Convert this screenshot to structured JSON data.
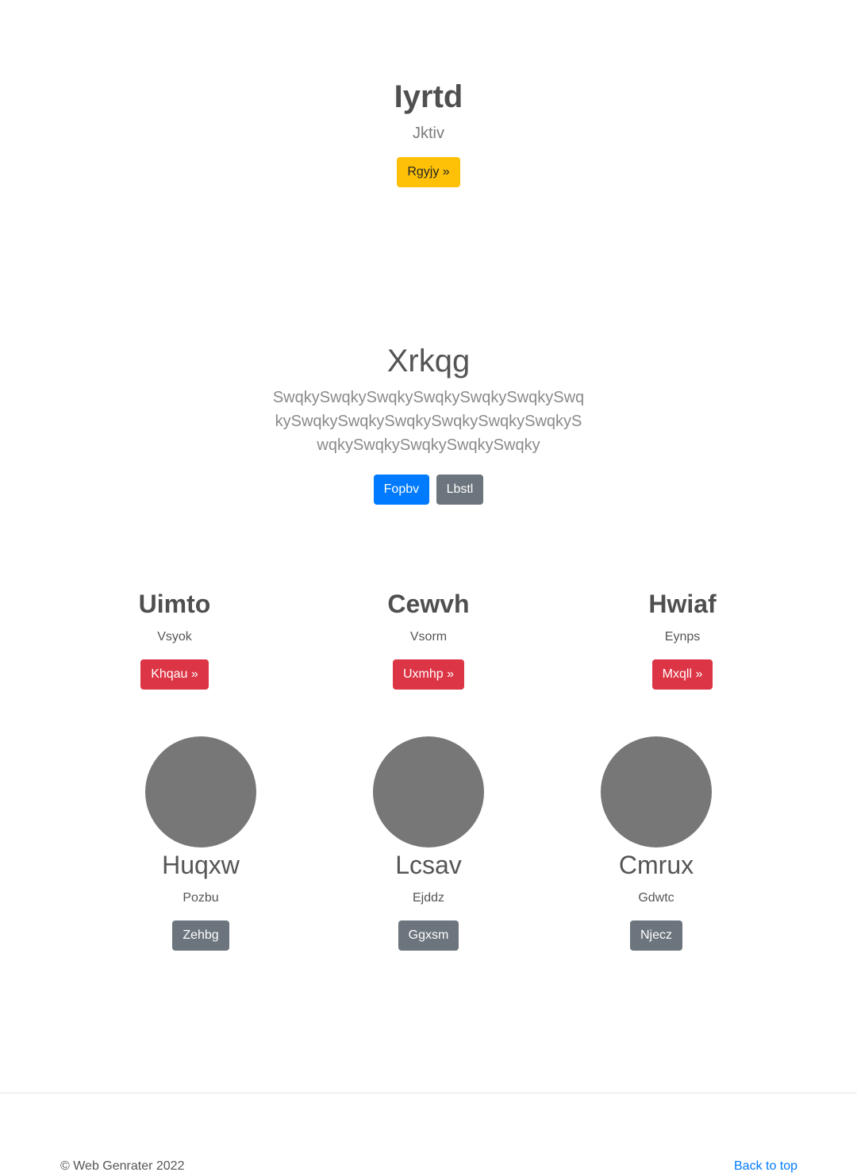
{
  "hero": {
    "title": "Iyrtd",
    "subtitle": "Jktiv",
    "button_label": "Rgyjy »"
  },
  "jumbotron": {
    "title": "Xrkqg",
    "lead": "SwqkySwqkySwqkySwqkySwqkySwqkySwqkySwqkySwqkySwqkySwqkySwqkySwqkySwqkySwqkySwqkySwqkySwqky",
    "primary_button": "Fopbv",
    "secondary_button": "Lbstl"
  },
  "features": [
    {
      "title": "Uimto",
      "text": "Vsyok",
      "button": "Khqau »"
    },
    {
      "title": "Cewvh",
      "text": "Vsorm",
      "button": "Uxmhp »"
    },
    {
      "title": "Hwiaf",
      "text": "Eynps",
      "button": "Mxqll »"
    }
  ],
  "profiles": [
    {
      "title": "Huqxw",
      "text": "Pozbu",
      "button": "Zehbg"
    },
    {
      "title": "Lcsav",
      "text": "Ejddz",
      "button": "Ggxsm"
    },
    {
      "title": "Cmrux",
      "text": "Gdwtc",
      "button": "Njecz"
    }
  ],
  "footer": {
    "copyright": "© Web Genrater 2022",
    "back_to_top": "Back to top"
  },
  "colors": {
    "warning": "#ffc107",
    "primary": "#007bff",
    "secondary": "#6c757d",
    "danger": "#dc3545",
    "placeholder_circle": "#777777"
  }
}
